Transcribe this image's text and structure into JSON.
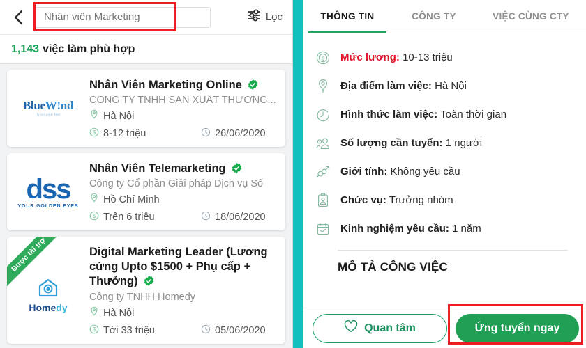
{
  "search": {
    "query": "Nhân viên Marketing",
    "placeholder": "Nhân viên Marketing",
    "back_icon": "back-chevron-icon",
    "filter_label": "Lọc",
    "filter_icon": "filter-sliders-icon"
  },
  "results": {
    "count": "1,143",
    "text": "việc làm phù hợp",
    "count_color": "#22a45d"
  },
  "jobs": [
    {
      "title": "Nhân Viên Marketing Online",
      "verified": true,
      "company": "CÔNG TY TNHH SẢN XUẤT THƯƠNG...",
      "location": "Hà Nội",
      "salary": "8-12 triệu",
      "date": "26/06/2020",
      "logo_text": "BlueWind",
      "logo_tagline": "fly on your feet",
      "sponsored": false
    },
    {
      "title": "Nhân Viên Telemarketing",
      "verified": true,
      "company": "Công ty Cổ phần Giải pháp Dịch vụ Số",
      "location": "Hồ Chí Minh",
      "salary": "Trên 6 triệu",
      "date": "18/06/2020",
      "logo_text": "dss",
      "logo_tagline": "YOUR GOLDEN EYES",
      "sponsored": false
    },
    {
      "title": "Digital Marketing Leader (Lương cứng Upto $1500 + Phụ cấp + Thưởng)",
      "verified": true,
      "company": "Công ty TNHH Homedy",
      "location": "Hà Nội",
      "salary": "Tới 33 triệu",
      "date": "05/06/2020",
      "logo_text": "Homedy",
      "logo_tagline": "",
      "sponsored": true,
      "ribbon_label": "Được tài trợ"
    }
  ],
  "detail": {
    "tabs": [
      {
        "label": "THÔNG TIN",
        "active": true
      },
      {
        "label": "CÔNG TY",
        "active": false
      },
      {
        "label": "VIỆC CÙNG CTY",
        "active": false
      }
    ],
    "rows": [
      {
        "icon": "money-coin-icon",
        "label": "Mức lương:",
        "value": "10-13 triệu",
        "label_color": "#e0132b"
      },
      {
        "icon": "location-pin-icon",
        "label": "Địa điểm làm việc:",
        "value": "Hà Nội",
        "label_color": "#1b1b1b"
      },
      {
        "icon": "clock-icon",
        "label": "Hình thức làm việc:",
        "value": "Toàn thời gian",
        "label_color": "#1b1b1b"
      },
      {
        "icon": "people-icon",
        "label": "Số lượng cần tuyển:",
        "value": "1 người",
        "label_color": "#1b1b1b"
      },
      {
        "icon": "gender-icon",
        "label": "Giới tính:",
        "value": "Không yêu cầu",
        "label_color": "#1b1b1b"
      },
      {
        "icon": "clipboard-person-icon",
        "label": "Chức vụ:",
        "value": "Trưởng nhóm",
        "label_color": "#1b1b1b"
      },
      {
        "icon": "calendar-check-icon",
        "label": "Kinh nghiệm yêu cầu:",
        "value": "1 năm",
        "label_color": "#1b1b1b"
      }
    ],
    "section_title": "MÔ TẢ CÔNG VIỆC"
  },
  "actions": {
    "interest_label": "Quan tâm",
    "interest_icon": "heart-icon",
    "apply_label": "Ứng tuyển ngay",
    "apply_color": "#21a055"
  },
  "accents": {
    "teal_strip": "#12c0bd",
    "green": "#22a45d",
    "annotation_red": "#ee1c25"
  }
}
